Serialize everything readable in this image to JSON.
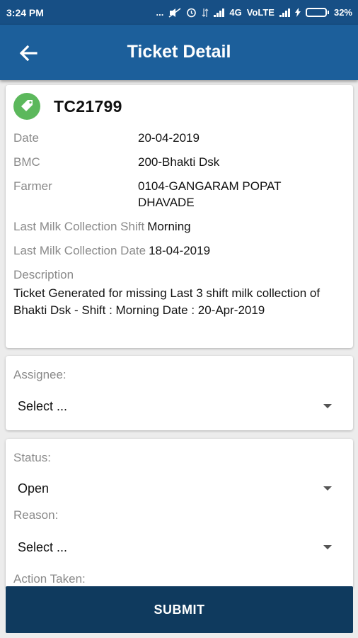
{
  "status_bar": {
    "time": "3:24 PM",
    "dots": "...",
    "network_type": "4G",
    "volte": "VoLTE",
    "battery_percent": "32%",
    "battery_level": 0.32
  },
  "appbar": {
    "title": "Ticket Detail",
    "back_icon": "arrow-back-icon"
  },
  "ticket": {
    "number": "TC21799",
    "icon": "tag-icon",
    "icon_color": "#5cb85c",
    "fields": [
      {
        "label": "Date",
        "value": "20-04-2019"
      },
      {
        "label": "BMC",
        "value": "200-Bhakti Dsk"
      },
      {
        "label": "Farmer",
        "value": "0104-GANGARAM POPAT DHAVADE"
      },
      {
        "label": "Last Milk Collection Shift",
        "value": "Morning"
      },
      {
        "label": "Last Milk Collection Date",
        "value": "18-04-2019"
      }
    ],
    "description_label": "Description",
    "description": "Ticket Generated for missing Last 3 shift milk collection of Bhakti Dsk - Shift : Morning Date : 20-Apr-2019"
  },
  "assignee": {
    "label": "Assignee:",
    "selected": "Select ..."
  },
  "status": {
    "label": "Status:",
    "selected": "Open"
  },
  "reason": {
    "label": "Reason:",
    "selected": "Select ..."
  },
  "action_taken": {
    "label": "Action Taken:"
  },
  "submit": {
    "label": "SUBMIT"
  },
  "colors": {
    "status_bar": "#174f85",
    "app_bar": "#1c5f9b",
    "submit_bg": "#0f3a5e",
    "label_gray": "#8a8a8a"
  }
}
